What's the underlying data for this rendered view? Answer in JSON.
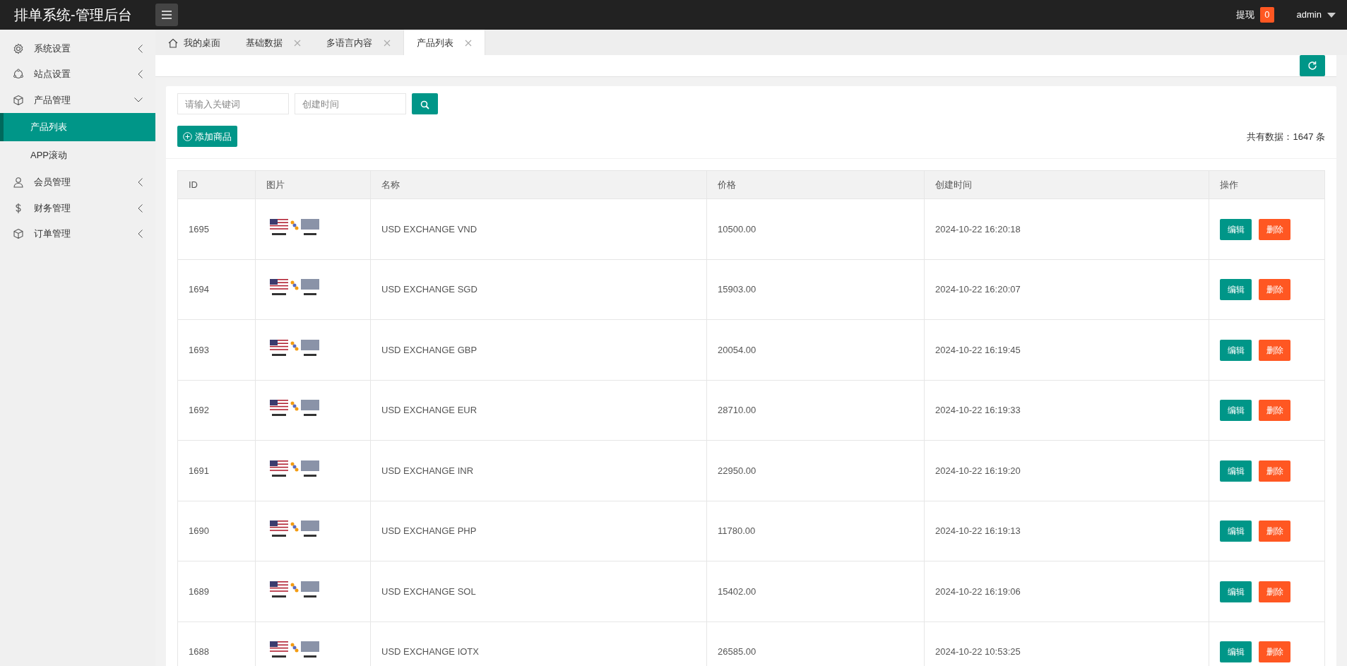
{
  "header": {
    "title": "排单系统-管理后台",
    "withdraw_label": "提现",
    "withdraw_count": "0",
    "user": "admin"
  },
  "sidebar": {
    "items": [
      {
        "label": "系统设置",
        "expanded": false,
        "selected": false
      },
      {
        "label": "站点设置",
        "expanded": false,
        "selected": false
      },
      {
        "label": "产品管理",
        "expanded": true,
        "selected": false,
        "children": [
          {
            "label": "产品列表",
            "selected": true
          },
          {
            "label": "APP滚动",
            "selected": false
          }
        ]
      },
      {
        "label": "会员管理",
        "expanded": false,
        "selected": false
      },
      {
        "label": "财务管理",
        "expanded": false,
        "selected": false
      },
      {
        "label": "订单管理",
        "expanded": false,
        "selected": false
      }
    ]
  },
  "tabs": [
    {
      "label": "我的桌面",
      "kind": "home",
      "selected": false
    },
    {
      "label": "基础数据",
      "kind": "page",
      "selected": false
    },
    {
      "label": "多语言内容",
      "kind": "page",
      "selected": false
    },
    {
      "label": "产品列表",
      "kind": "page",
      "selected": true
    }
  ],
  "search": {
    "keyword_placeholder": "请输入关键词",
    "date_placeholder": "创建时间"
  },
  "add_button": "添加商品",
  "total": "共有数据：1647 条",
  "table": {
    "columns": [
      "ID",
      "图片",
      "名称",
      "价格",
      "创建时间",
      "操作"
    ],
    "rows": [
      {
        "id": "1695",
        "name": "USD EXCHANGE VND",
        "price": "10500.00",
        "created": "2024-10-22 16:20:18",
        "actions": [
          {
            "label": "编辑",
            "kind": "edit"
          },
          {
            "label": "删除",
            "kind": "delete"
          }
        ]
      },
      {
        "id": "1694",
        "name": "USD EXCHANGE SGD",
        "price": "15903.00",
        "created": "2024-10-22 16:20:07",
        "actions": [
          {
            "label": "编辑",
            "kind": "edit"
          },
          {
            "label": "删除",
            "kind": "delete"
          }
        ]
      },
      {
        "id": "1693",
        "name": "USD EXCHANGE GBP",
        "price": "20054.00",
        "created": "2024-10-22 16:19:45",
        "actions": [
          {
            "label": "编辑",
            "kind": "edit"
          },
          {
            "label": "删除",
            "kind": "delete"
          }
        ]
      },
      {
        "id": "1692",
        "name": "USD EXCHANGE EUR",
        "price": "28710.00",
        "created": "2024-10-22 16:19:33",
        "actions": [
          {
            "label": "编辑",
            "kind": "edit"
          },
          {
            "label": "删除",
            "kind": "delete"
          }
        ]
      },
      {
        "id": "1691",
        "name": "USD EXCHANGE INR",
        "price": "22950.00",
        "created": "2024-10-22 16:19:20",
        "actions": [
          {
            "label": "编辑",
            "kind": "edit"
          },
          {
            "label": "删除",
            "kind": "delete"
          }
        ]
      },
      {
        "id": "1690",
        "name": "USD EXCHANGE PHP",
        "price": "11780.00",
        "created": "2024-10-22 16:19:13",
        "actions": [
          {
            "label": "编辑",
            "kind": "edit"
          },
          {
            "label": "删除",
            "kind": "delete"
          }
        ]
      },
      {
        "id": "1689",
        "name": "USD EXCHANGE SOL",
        "price": "15402.00",
        "created": "2024-10-22 16:19:06",
        "actions": [
          {
            "label": "编辑",
            "kind": "edit"
          },
          {
            "label": "删除",
            "kind": "delete"
          }
        ]
      },
      {
        "id": "1688",
        "name": "USD EXCHANGE IOTX",
        "price": "26585.00",
        "created": "2024-10-22 10:53:25",
        "actions": [
          {
            "label": "编辑",
            "kind": "edit"
          },
          {
            "label": "删除",
            "kind": "delete"
          }
        ]
      }
    ]
  }
}
